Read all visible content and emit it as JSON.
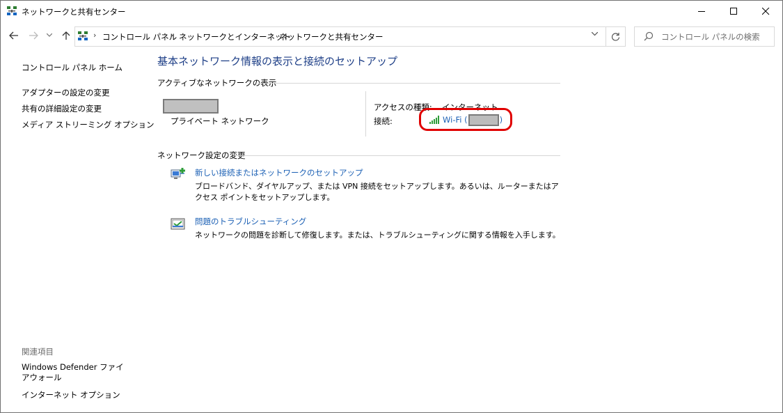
{
  "window": {
    "title": "ネットワークと共有センター",
    "controls": {
      "minimize": "minimize",
      "maximize": "maximize",
      "close": "close"
    }
  },
  "address": {
    "crumbs": [
      "コントロール パネル",
      "ネットワークとインターネット",
      "ネットワークと共有センター"
    ],
    "search_placeholder": "コントロール パネルの検索"
  },
  "left_pane": {
    "home": "コントロール パネル ホーム",
    "links": [
      "アダプターの設定の変更",
      "共有の詳細設定の変更",
      "メディア ストリーミング オプション"
    ],
    "related_heading": "関連項目",
    "related": [
      "Windows Defender ファイアウォール",
      "インターネット オプション"
    ]
  },
  "main": {
    "title": "基本ネットワーク情報の表示と接続のセットアップ",
    "active_networks_label": "アクティブなネットワークの表示",
    "network_type": "プライベート ネットワーク",
    "access_type_label": "アクセスの種類:",
    "access_type_value": "インターネット",
    "connection_label": "接続:",
    "connection_prefix": "Wi-Fi (",
    "connection_suffix": ")",
    "change_settings_label": "ネットワーク設定の変更",
    "tasks": [
      {
        "link": "新しい接続またはネットワークのセットアップ",
        "desc": "ブロードバンド、ダイヤルアップ、または VPN 接続をセットアップします。あるいは、ルーターまたはアクセス ポイントをセットアップします。"
      },
      {
        "link": "問題のトラブルシューティング",
        "desc": "ネットワークの問題を診断して修復します。または、トラブルシューティングに関する情報を入手します。"
      }
    ]
  },
  "colors": {
    "link": "#1a5fb4",
    "title": "#1e3f87",
    "highlight": "#e00000"
  },
  "icons": [
    "network-center-icon",
    "wifi-signal-icon",
    "new-connection-icon",
    "troubleshoot-icon",
    "search-icon",
    "refresh-icon"
  ]
}
